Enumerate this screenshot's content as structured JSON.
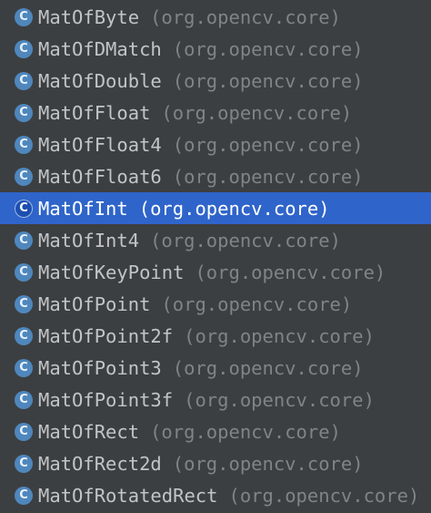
{
  "colors": {
    "background": "#3c3f41",
    "selection": "#2f65ca",
    "class_badge": "#4f87bd",
    "name_text": "#c2c5c8",
    "package_text": "#7f8487"
  },
  "completion_popup": {
    "items": [
      {
        "icon": "class-icon",
        "badge": "C",
        "name": "MatOfByte",
        "package": "(org.opencv.core)",
        "selected": false
      },
      {
        "icon": "class-icon",
        "badge": "C",
        "name": "MatOfDMatch",
        "package": "(org.opencv.core)",
        "selected": false
      },
      {
        "icon": "class-icon",
        "badge": "C",
        "name": "MatOfDouble",
        "package": "(org.opencv.core)",
        "selected": false
      },
      {
        "icon": "class-icon",
        "badge": "C",
        "name": "MatOfFloat",
        "package": "(org.opencv.core)",
        "selected": false
      },
      {
        "icon": "class-icon",
        "badge": "C",
        "name": "MatOfFloat4",
        "package": "(org.opencv.core)",
        "selected": false
      },
      {
        "icon": "class-icon",
        "badge": "C",
        "name": "MatOfFloat6",
        "package": "(org.opencv.core)",
        "selected": false
      },
      {
        "icon": "class-icon",
        "badge": "C",
        "name": "MatOfInt",
        "package": "(org.opencv.core)",
        "selected": true
      },
      {
        "icon": "class-icon",
        "badge": "C",
        "name": "MatOfInt4",
        "package": "(org.opencv.core)",
        "selected": false
      },
      {
        "icon": "class-icon",
        "badge": "C",
        "name": "MatOfKeyPoint",
        "package": "(org.opencv.core)",
        "selected": false
      },
      {
        "icon": "class-icon",
        "badge": "C",
        "name": "MatOfPoint",
        "package": "(org.opencv.core)",
        "selected": false
      },
      {
        "icon": "class-icon",
        "badge": "C",
        "name": "MatOfPoint2f",
        "package": "(org.opencv.core)",
        "selected": false
      },
      {
        "icon": "class-icon",
        "badge": "C",
        "name": "MatOfPoint3",
        "package": "(org.opencv.core)",
        "selected": false
      },
      {
        "icon": "class-icon",
        "badge": "C",
        "name": "MatOfPoint3f",
        "package": "(org.opencv.core)",
        "selected": false
      },
      {
        "icon": "class-icon",
        "badge": "C",
        "name": "MatOfRect",
        "package": "(org.opencv.core)",
        "selected": false
      },
      {
        "icon": "class-icon",
        "badge": "C",
        "name": "MatOfRect2d",
        "package": "(org.opencv.core)",
        "selected": false
      },
      {
        "icon": "class-icon",
        "badge": "C",
        "name": "MatOfRotatedRect",
        "package": "(org.opencv.core)",
        "selected": false
      }
    ]
  }
}
